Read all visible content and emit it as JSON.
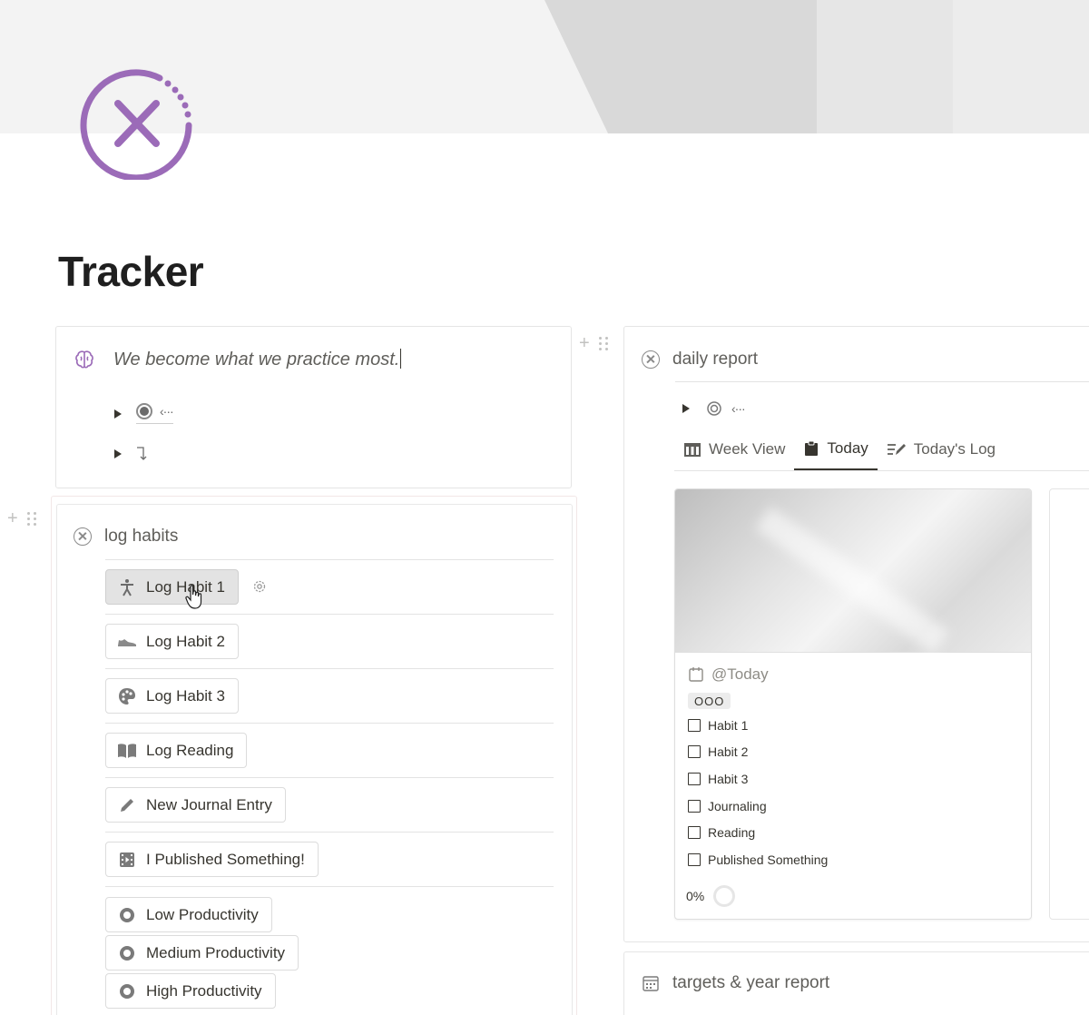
{
  "page": {
    "title": "Tracker"
  },
  "quote_block": {
    "text": "We become what we practice most."
  },
  "log_habits": {
    "title": "log habits",
    "buttons": [
      {
        "label": "Log Habit 1",
        "icon": "person-icon"
      },
      {
        "label": "Log Habit 2",
        "icon": "shoe-icon"
      },
      {
        "label": "Log Habit 3",
        "icon": "palette-icon"
      },
      {
        "label": "Log Reading",
        "icon": "book-icon"
      },
      {
        "label": "New Journal Entry",
        "icon": "pencil-icon"
      },
      {
        "label": "I Published Something!",
        "icon": "film-icon"
      },
      {
        "label": "Low Productivity",
        "icon": "target-icon"
      },
      {
        "label": "Medium Productivity",
        "icon": "target-icon"
      },
      {
        "label": "High Productivity",
        "icon": "target-icon"
      }
    ]
  },
  "daily_report": {
    "title": "daily report",
    "tabs": [
      {
        "label": "Week View",
        "icon": "calendar-grid-icon"
      },
      {
        "label": "Today",
        "icon": "clipboard-icon"
      },
      {
        "label": "Today's Log",
        "icon": "edit-list-icon"
      }
    ],
    "selected_tab": "Today",
    "card": {
      "date": "@Today",
      "tag": "OOO",
      "checklist": [
        "Habit 1",
        "Habit 2",
        "Habit 3",
        "Journaling",
        "Reading",
        "Published Something"
      ],
      "progress": "0%"
    }
  },
  "targets": {
    "title": "targets & year report"
  },
  "colors": {
    "accent": "#9b6bb8",
    "text": "#37352f",
    "muted": "#5f5e5a"
  }
}
